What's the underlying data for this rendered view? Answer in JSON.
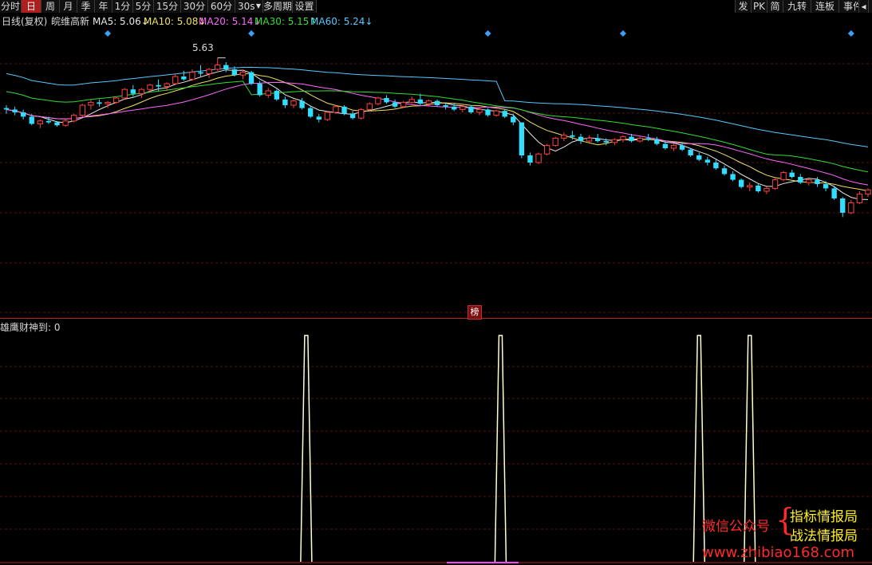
{
  "toolbar": {
    "periods": [
      "分时",
      "日",
      "周",
      "月",
      "季",
      "年",
      "1分",
      "5分",
      "15分",
      "30分",
      "60分",
      "30s",
      "多周期",
      "设置"
    ],
    "active_index": 1,
    "dropdown_arrow": "▼",
    "right_buttons": [
      "发",
      "PK",
      "简",
      "九转",
      "连板",
      "事件"
    ],
    "right_arrow": "◂",
    "edge": "▕"
  },
  "chart_header": {
    "period_label": "日线(复权)",
    "stock_name": "皖维高新",
    "ma": [
      {
        "label": "MA5: 5.06",
        "arrow": "↓",
        "color": "#e8e8e8"
      },
      {
        "label": "MA10: 5.08",
        "arrow": "↓",
        "color": "#f0e060"
      },
      {
        "label": "MA20: 5.14",
        "arrow": "↓",
        "color": "#ff66ff"
      },
      {
        "label": "MA30: 5.15",
        "arrow": "↑",
        "color": "#33dd33"
      },
      {
        "label": "MA60: 5.24",
        "arrow": "↓",
        "color": "#55c8ff"
      }
    ]
  },
  "price_chart": {
    "high_marker": "5.63",
    "badge": "榜",
    "colors": {
      "up": "#ff4040",
      "down": "#33ddff",
      "flat": "#ffffff",
      "signal_diamond": "#3aa0ff"
    }
  },
  "indicator": {
    "title": "雄鹰财神到: 0",
    "line_color": "#ffffcc"
  },
  "watermark": {
    "left": "微信公众号",
    "right_top": "指标情报局",
    "right_bottom": "战法情报局",
    "url": "www.zhibiao168.com",
    "colors": {
      "red": "#ff2a2a",
      "yellow": "#ffee22"
    }
  },
  "chart_data": [
    {
      "type": "candlestick",
      "title": "日线(复权) 皖维高新",
      "ylim": [
        4.2,
        5.8
      ],
      "moving_averages": {
        "MA5": 5.06,
        "MA10": 5.08,
        "MA20": 5.14,
        "MA30": 5.15,
        "MA60": 5.24
      },
      "annotations": [
        "5.63"
      ],
      "ohlc": [
        [
          5.28,
          5.3,
          5.24,
          5.27
        ],
        [
          5.27,
          5.29,
          5.23,
          5.25
        ],
        [
          5.25,
          5.27,
          5.2,
          5.22
        ],
        [
          5.22,
          5.24,
          5.16,
          5.17
        ],
        [
          5.17,
          5.2,
          5.14,
          5.19
        ],
        [
          5.19,
          5.22,
          5.17,
          5.18
        ],
        [
          5.18,
          5.19,
          5.15,
          5.16
        ],
        [
          5.16,
          5.2,
          5.15,
          5.19
        ],
        [
          5.19,
          5.24,
          5.18,
          5.23
        ],
        [
          5.23,
          5.31,
          5.22,
          5.3
        ],
        [
          5.3,
          5.34,
          5.27,
          5.32
        ],
        [
          5.32,
          5.34,
          5.29,
          5.31
        ],
        [
          5.31,
          5.33,
          5.28,
          5.32
        ],
        [
          5.32,
          5.36,
          5.31,
          5.35
        ],
        [
          5.35,
          5.42,
          5.34,
          5.41
        ],
        [
          5.41,
          5.44,
          5.36,
          5.38
        ],
        [
          5.38,
          5.42,
          5.35,
          5.41
        ],
        [
          5.41,
          5.45,
          5.39,
          5.44
        ],
        [
          5.44,
          5.48,
          5.4,
          5.43
        ],
        [
          5.43,
          5.46,
          5.4,
          5.45
        ],
        [
          5.45,
          5.52,
          5.44,
          5.5
        ],
        [
          5.5,
          5.54,
          5.47,
          5.48
        ],
        [
          5.48,
          5.55,
          5.47,
          5.53
        ],
        [
          5.53,
          5.58,
          5.5,
          5.52
        ],
        [
          5.52,
          5.56,
          5.49,
          5.55
        ],
        [
          5.55,
          5.63,
          5.54,
          5.58
        ],
        [
          5.58,
          5.6,
          5.53,
          5.55
        ],
        [
          5.55,
          5.57,
          5.5,
          5.51
        ],
        [
          5.51,
          5.55,
          5.48,
          5.53
        ],
        [
          5.53,
          5.54,
          5.44,
          5.45
        ],
        [
          5.45,
          5.47,
          5.36,
          5.37
        ],
        [
          5.37,
          5.42,
          5.35,
          5.4
        ],
        [
          5.4,
          5.41,
          5.33,
          5.34
        ],
        [
          5.34,
          5.36,
          5.28,
          5.3
        ],
        [
          5.3,
          5.34,
          5.28,
          5.33
        ],
        [
          5.33,
          5.35,
          5.27,
          5.28
        ],
        [
          5.28,
          5.29,
          5.21,
          5.22
        ],
        [
          5.22,
          5.24,
          5.18,
          5.2
        ],
        [
          5.2,
          5.26,
          5.19,
          5.25
        ],
        [
          5.25,
          5.3,
          5.24,
          5.29
        ],
        [
          5.29,
          5.3,
          5.23,
          5.24
        ],
        [
          5.24,
          5.26,
          5.2,
          5.21
        ],
        [
          5.21,
          5.28,
          5.2,
          5.27
        ],
        [
          5.27,
          5.32,
          5.26,
          5.31
        ],
        [
          5.31,
          5.36,
          5.3,
          5.35
        ],
        [
          5.35,
          5.37,
          5.31,
          5.32
        ],
        [
          5.32,
          5.34,
          5.28,
          5.29
        ],
        [
          5.29,
          5.33,
          5.28,
          5.32
        ],
        [
          5.32,
          5.36,
          5.31,
          5.34
        ],
        [
          5.34,
          5.38,
          5.3,
          5.31
        ],
        [
          5.31,
          5.34,
          5.29,
          5.33
        ],
        [
          5.33,
          5.34,
          5.29,
          5.3
        ],
        [
          5.3,
          5.32,
          5.27,
          5.29
        ],
        [
          5.29,
          5.31,
          5.26,
          5.27
        ],
        [
          5.27,
          5.3,
          5.25,
          5.29
        ],
        [
          5.29,
          5.3,
          5.24,
          5.25
        ],
        [
          5.25,
          5.28,
          5.23,
          5.27
        ],
        [
          5.27,
          5.28,
          5.22,
          5.23
        ],
        [
          5.23,
          5.27,
          5.22,
          5.26
        ],
        [
          5.26,
          5.27,
          5.21,
          5.22
        ],
        [
          5.22,
          5.24,
          5.16,
          5.18
        ],
        [
          5.18,
          5.18,
          4.93,
          4.95
        ],
        [
          4.95,
          4.97,
          4.88,
          4.9
        ],
        [
          4.9,
          4.97,
          4.89,
          4.96
        ],
        [
          4.96,
          5.03,
          4.95,
          5.02
        ],
        [
          5.02,
          5.08,
          5.01,
          5.07
        ],
        [
          5.07,
          5.11,
          5.05,
          5.09
        ],
        [
          5.09,
          5.12,
          5.06,
          5.08
        ],
        [
          5.08,
          5.1,
          5.03,
          5.05
        ],
        [
          5.05,
          5.09,
          5.04,
          5.07
        ],
        [
          5.07,
          5.1,
          5.04,
          5.05
        ],
        [
          5.05,
          5.07,
          5.02,
          5.04
        ],
        [
          5.04,
          5.07,
          5.02,
          5.06
        ],
        [
          5.06,
          5.09,
          5.04,
          5.08
        ],
        [
          5.08,
          5.1,
          5.04,
          5.05
        ],
        [
          5.05,
          5.08,
          5.04,
          5.07
        ],
        [
          5.07,
          5.1,
          5.05,
          5.06
        ],
        [
          5.06,
          5.08,
          5.02,
          5.03
        ],
        [
          5.03,
          5.05,
          4.99,
          5.0
        ],
        [
          5.0,
          5.03,
          4.98,
          5.02
        ],
        [
          5.02,
          5.04,
          4.98,
          4.99
        ],
        [
          4.99,
          5.0,
          4.94,
          4.95
        ],
        [
          4.95,
          4.97,
          4.91,
          4.92
        ],
        [
          4.92,
          4.94,
          4.88,
          4.9
        ],
        [
          4.9,
          4.92,
          4.85,
          4.86
        ],
        [
          4.86,
          4.88,
          4.81,
          4.82
        ],
        [
          4.82,
          4.84,
          4.77,
          4.78
        ],
        [
          4.78,
          4.79,
          4.72,
          4.73
        ],
        [
          4.73,
          4.76,
          4.7,
          4.74
        ],
        [
          4.74,
          4.75,
          4.69,
          4.7
        ],
        [
          4.7,
          4.73,
          4.68,
          4.72
        ],
        [
          4.72,
          4.79,
          4.71,
          4.78
        ],
        [
          4.78,
          4.84,
          4.77,
          4.83
        ],
        [
          4.83,
          4.85,
          4.79,
          4.8
        ],
        [
          4.8,
          4.82,
          4.75,
          4.76
        ],
        [
          4.76,
          4.79,
          4.74,
          4.78
        ],
        [
          4.78,
          4.8,
          4.73,
          4.75
        ],
        [
          4.75,
          4.77,
          4.7,
          4.72
        ],
        [
          4.72,
          4.74,
          4.64,
          4.65
        ],
        [
          4.65,
          4.66,
          4.52,
          4.55
        ],
        [
          4.55,
          4.64,
          4.54,
          4.62
        ],
        [
          4.62,
          4.7,
          4.61,
          4.68
        ],
        [
          4.68,
          4.72,
          4.66,
          4.71
        ]
      ],
      "signal_diamonds": [
        12,
        29,
        57,
        73,
        100
      ]
    },
    {
      "type": "line",
      "title": "雄鹰财神到",
      "values_note": "signal line, value 0 except spikes",
      "spikes": [
        35.5,
        58.5,
        82,
        88
      ],
      "current_value": 0
    }
  ]
}
